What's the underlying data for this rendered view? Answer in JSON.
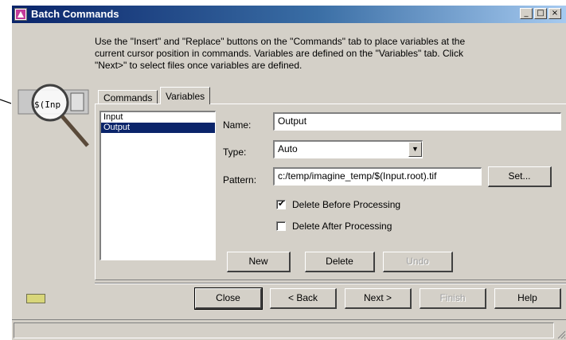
{
  "window": {
    "title": "Batch Commands",
    "minimize": "_",
    "maximize": "□",
    "close": "×"
  },
  "instructions": "Use the \"Insert\" and \"Replace\" buttons on the \"Commands\" tab to place variables at the current cursor position in commands. Variables are defined on the \"Variables\" tab. Click \"Next>\" to select files once variables are defined.",
  "magnifier": {
    "label": "$(Inp"
  },
  "tabs": [
    {
      "label": "Commands",
      "active": false
    },
    {
      "label": "Variables",
      "active": true
    }
  ],
  "variables": {
    "list": [
      {
        "label": "Input",
        "selected": false
      },
      {
        "label": "Output",
        "selected": true
      }
    ],
    "name_label": "Name:",
    "name_value": "Output",
    "type_label": "Type:",
    "type_value": "Auto",
    "pattern_label": "Pattern:",
    "pattern_value": "c:/temp/imagine_temp/$(Input.root).tif",
    "set_button": "Set...",
    "delete_before": {
      "label": "Delete Before Processing",
      "checked": true
    },
    "delete_after": {
      "label": "Delete After Processing",
      "checked": false
    },
    "new_button": "New",
    "delete_button": "Delete",
    "undo_button": "Undo"
  },
  "footer": {
    "close": "Close",
    "back": "< Back",
    "next": "Next >",
    "finish": "Finish",
    "help": "Help"
  },
  "colors": {
    "face": "#d4d0c8",
    "title_start": "#0a246a",
    "selection": "#0a246a",
    "indicator": "#d8d67a"
  },
  "icons": [
    "app-icon",
    "magnifier-icon",
    "dropdown-arrow-icon",
    "size-grip-icon"
  ]
}
